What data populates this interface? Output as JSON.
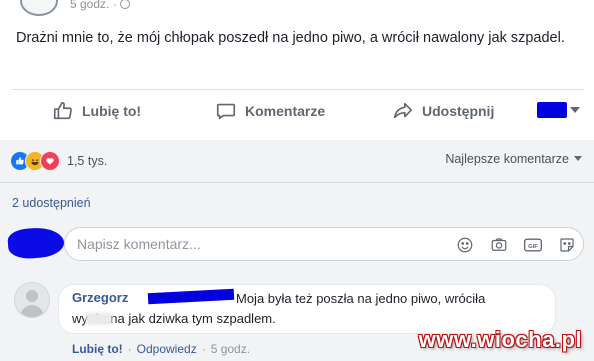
{
  "post": {
    "time": "5 godz. · ",
    "text": "Drażni mnie to, że mój chłopak poszedł na jedno piwo, a wrócił nawalony jak szpadel."
  },
  "actions": {
    "like": "Lubię to!",
    "comment": "Komentarze",
    "share": "Udostępnij"
  },
  "reactions": {
    "count": "1,5 tys.",
    "sort_label": "Najlepsze komentarze"
  },
  "shares": "2 udostępnień",
  "composer": {
    "placeholder": "Napisz komentarz..."
  },
  "comment": {
    "author": "Grzegorz",
    "text_line1": "Moja była też poszła na jedno piwo, wróciła",
    "text_line2": "wyr    hana jak dziwka tym szpadlem.",
    "like": "Lubię to!",
    "separator": "·",
    "reply": "Odpowiedz",
    "time": "5 godz."
  },
  "watermark": "www.wiocha.pl",
  "colors": {
    "link": "#385898",
    "redaction": "#0000e0",
    "like_reaction": "#1877f2",
    "haha_reaction": "#f7b125",
    "love_reaction": "#f33e58"
  },
  "icons": [
    "thumbs-up-icon",
    "comment-bubble-icon",
    "share-arrow-icon",
    "caret-down-icon",
    "emoji-icon",
    "camera-icon",
    "gif-icon",
    "sticker-icon",
    "globe-icon"
  ]
}
